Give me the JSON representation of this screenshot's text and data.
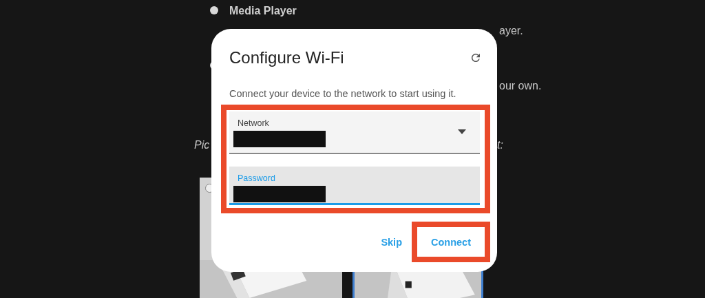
{
  "background": {
    "options": [
      {
        "title": "Media Player",
        "fragment": "ayer."
      },
      {
        "fragment": "our own."
      }
    ],
    "prompt_start": "Pic",
    "prompt_end": "t:",
    "cards": [
      {
        "kind": "picture",
        "selected": false
      },
      {
        "kind": "picture",
        "selected": true
      }
    ]
  },
  "dialog": {
    "title": "Configure Wi-Fi",
    "description": "Connect your device to the network to start using it.",
    "fields": [
      {
        "label": "Network",
        "kind": "dropdown",
        "focused": false,
        "redacted": true
      },
      {
        "label": "Password",
        "kind": "text",
        "focused": true,
        "redacted": true
      }
    ],
    "buttons": [
      {
        "label": "Skip",
        "highlighted": false
      },
      {
        "label": "Connect",
        "highlighted": true
      }
    ]
  }
}
